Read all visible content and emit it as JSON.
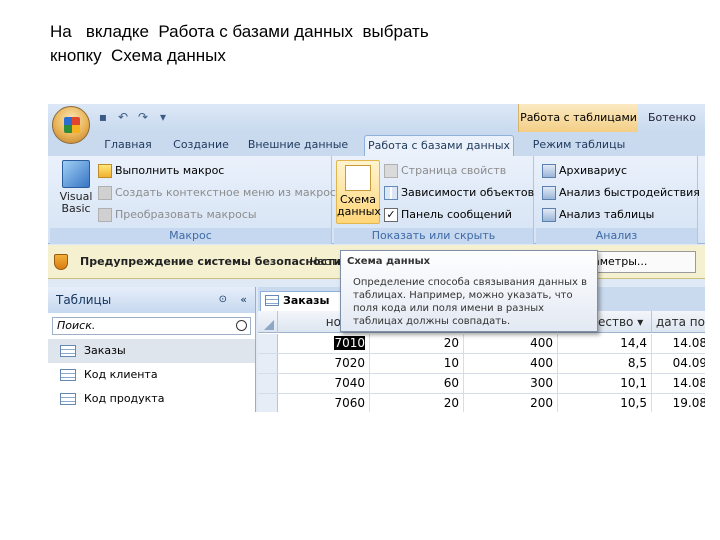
{
  "caption": "На   вкладке  Работа с базами данных  выбрать\nкнопку  Схема данных",
  "titlebar": {
    "context_tab": "Работа с таблицами",
    "window_title": "Ботенко"
  },
  "tabs": [
    "Главная",
    "Создание",
    "Внешние данные",
    "Работа с базами данных",
    "Режим таблицы"
  ],
  "ribbon": {
    "macro_group": {
      "label": "Макрос",
      "vb_label": "Visual\nBasic",
      "run_macro": "Выполнить макрос",
      "create_menu": "Создать контекстное меню из макроса",
      "convert_macros": "Преобразовать макросы"
    },
    "show_group": {
      "label": "Показать или скрыть",
      "schema_label": "Схема\nданных",
      "props": "Страница свойств",
      "deps": "Зависимости объектов",
      "msgbar": "Панель сообщений",
      "msgbar_checked": "✓"
    },
    "analysis_group": {
      "label": "Анализ",
      "archiver": "Архивариус",
      "perf": "Анализ быстродействия",
      "table": "Анализ таблицы"
    }
  },
  "security_bar": {
    "title": "Предупреждение системы безопасности",
    "more": "Часть",
    "params": "аметры..."
  },
  "nav": {
    "title": "Таблицы",
    "chevron": "⊙",
    "close": "«",
    "search_placeholder": "Поиск.",
    "items": [
      "Заказы",
      "Код клиента",
      "Код продукта"
    ]
  },
  "sheet": {
    "tab": "Заказы",
    "columns": [
      "номер",
      "",
      "",
      "ество ▾",
      "дата пос"
    ],
    "rows": [
      [
        "7010",
        "20",
        "400",
        "14,4",
        "14.08"
      ],
      [
        "7020",
        "10",
        "400",
        "8,5",
        "04.09"
      ],
      [
        "7040",
        "60",
        "300",
        "10,1",
        "14.08"
      ],
      [
        "7060",
        "20",
        "200",
        "10,5",
        "19.08"
      ]
    ]
  },
  "tooltip": {
    "title": "Схема данных",
    "body": "Определение способа связывания данных в таблицах. Например, можно указать, что поля кода или поля имени в разных таблицах должны совпадать."
  },
  "colors": {
    "accent": "#2c5b94",
    "ribbon": "#dfe9f5",
    "security": "#f4f0d0"
  }
}
